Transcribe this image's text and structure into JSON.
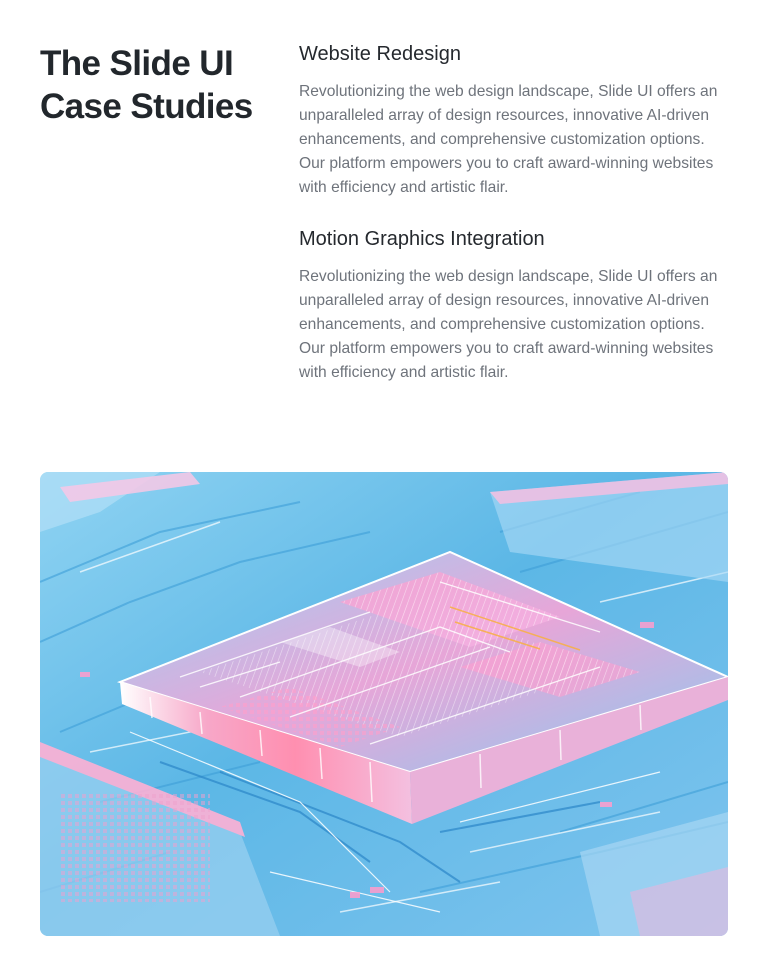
{
  "header": {
    "title": "The Slide UI Case Studies"
  },
  "case_studies": [
    {
      "title": "Website Redesign",
      "description": "Revolutionizing the web design landscape, Slide UI offers an unparalleled array of design resources, innovative AI-driven enhancements, and comprehensive customization options. Our platform empowers you to craft award-winning websites with efficiency and artistic flair."
    },
    {
      "title": "Motion Graphics Integration",
      "description": "Revolutionizing the web design landscape, Slide UI offers an unparalleled array of design resources, innovative AI-driven enhancements, and comprehensive customization options. Our platform empowers you to craft award-winning websites with efficiency and artistic flair."
    }
  ],
  "colors": {
    "heading": "#22272c",
    "body_text": "#6e737b",
    "image_blue": "#5cb7e6",
    "image_pink": "#f09ac8"
  }
}
